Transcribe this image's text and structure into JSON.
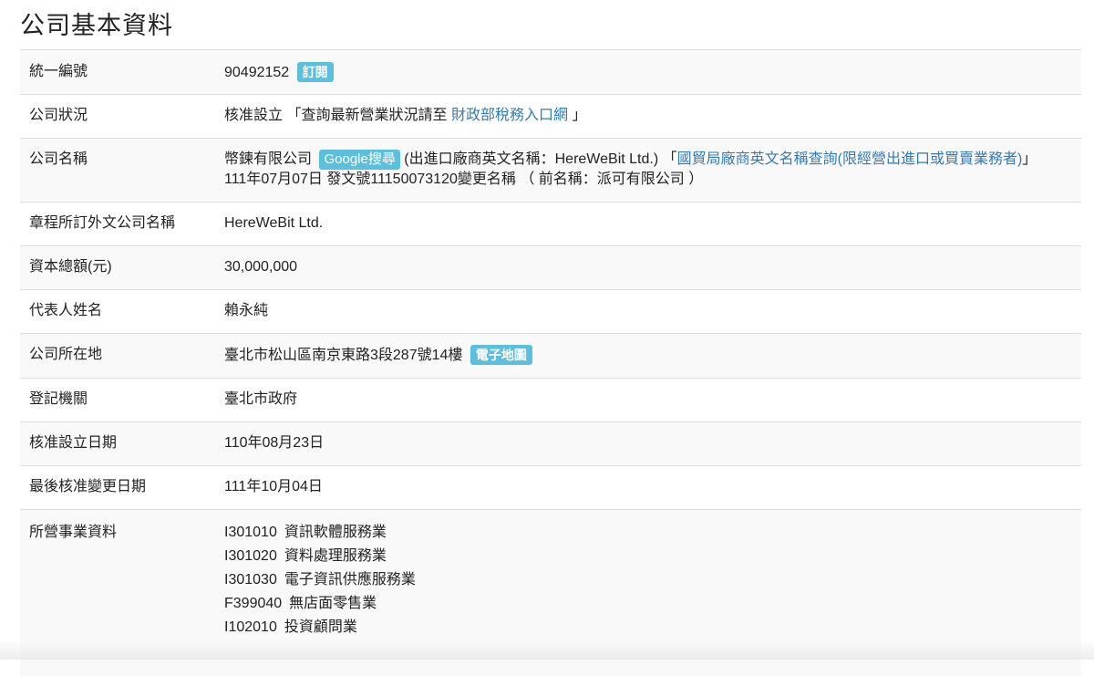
{
  "title": "公司基本資料",
  "rows": {
    "tax_id": {
      "label": "統一編號",
      "value": "90492152",
      "subscribe": "訂閱"
    },
    "status": {
      "label": "公司狀況",
      "value": "核准設立",
      "open_bracket": "「查詢最新營業狀況請至",
      "link": "財政部稅務入口網",
      "close_bracket": "」"
    },
    "name": {
      "label": "公司名稱",
      "value": "幣鍊有限公司",
      "google": "Google搜尋",
      "export_note": "(出進口廠商英文名稱：HereWeBit Ltd.)",
      "open_bracket": "「",
      "export_link": "國貿局廠商英文名稱查詢(限經營出進口或買賣業務者)",
      "close_bracket": "」",
      "change_note": "111年07月07日 發文號11150073120變更名稱 （ 前名稱：派可有限公司 ）"
    },
    "foreign_name": {
      "label": "章程所訂外文公司名稱",
      "value": "HereWeBit Ltd."
    },
    "capital": {
      "label": "資本總額(元)",
      "value": "30,000,000"
    },
    "representative": {
      "label": "代表人姓名",
      "value": "賴永純"
    },
    "address": {
      "label": "公司所在地",
      "value": "臺北市松山區南京東路3段287號14樓",
      "map": "電子地圖"
    },
    "authority": {
      "label": "登記機關",
      "value": "臺北市政府"
    },
    "setup_date": {
      "label": "核准設立日期",
      "value": "110年08月23日"
    },
    "change_date": {
      "label": "最後核准變更日期",
      "value": "111年10月04日"
    },
    "business": {
      "label": "所營事業資料",
      "items": [
        {
          "code": "I301010",
          "name": "資訊軟體服務業"
        },
        {
          "code": "I301020",
          "name": "資料處理服務業"
        },
        {
          "code": "I301030",
          "name": "電子資訊供應服務業"
        },
        {
          "code": "F399040",
          "name": "無店面零售業"
        },
        {
          "code": "I102010",
          "name": "投資顧問業"
        }
      ]
    }
  },
  "colors": {
    "badge": "#5bc0de",
    "link": "#337ab7",
    "stripe": "#f9f9f9"
  }
}
